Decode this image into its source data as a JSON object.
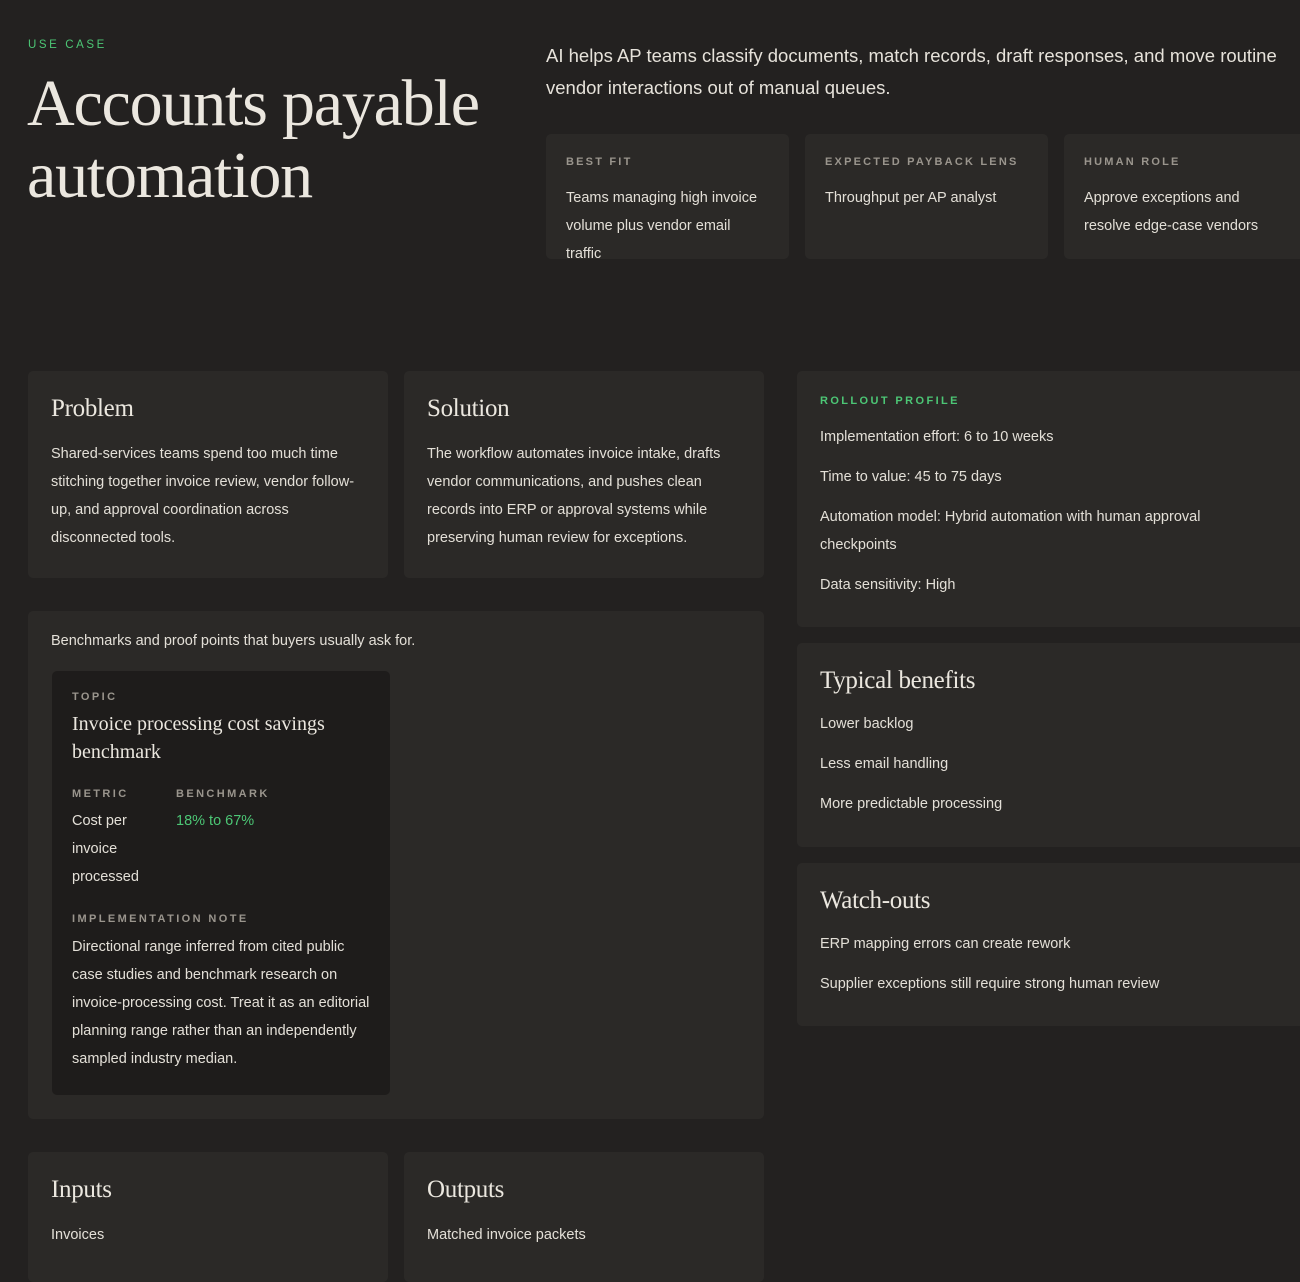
{
  "hero": {
    "eyebrow": "USE CASE",
    "title": "Accounts payable automation",
    "summary": "AI helps AP teams classify documents, match records, draft responses, and move routine vendor interactions out of manual queues."
  },
  "facts": [
    {
      "label": "BEST FIT",
      "value": "Teams managing high invoice volume plus vendor email traffic"
    },
    {
      "label": "EXPECTED PAYBACK LENS",
      "value": "Throughput per AP analyst"
    },
    {
      "label": "HUMAN ROLE",
      "value": "Approve exceptions and resolve edge-case vendors"
    }
  ],
  "problem": {
    "heading": "Problem",
    "text": "Shared-services teams spend too much time stitching together invoice review, vendor follow-up, and approval coordination across disconnected tools."
  },
  "solution": {
    "heading": "Solution",
    "text": "The workflow automates invoice intake, drafts vendor communications, and pushes clean records into ERP or approval systems while preserving human review for exceptions."
  },
  "benchmarks": {
    "intro": "Benchmarks and proof points that buyers usually ask for.",
    "card": {
      "topic_label": "TOPIC",
      "topic": "Invoice processing cost savings benchmark",
      "metric_label": "METRIC",
      "metric": "Cost per invoice processed",
      "benchmark_label": "BENCHMARK",
      "benchmark": "18% to 67%",
      "note_label": "IMPLEMENTATION NOTE",
      "note": "Directional range inferred from cited public case studies and benchmark research on invoice-processing cost. Treat it as an editorial planning range rather than an independently sampled industry median."
    }
  },
  "inputs": {
    "heading": "Inputs",
    "items": [
      "Invoices"
    ]
  },
  "outputs": {
    "heading": "Outputs",
    "items": [
      "Matched invoice packets"
    ]
  },
  "rollout": {
    "label": "ROLLOUT PROFILE",
    "items": [
      "Implementation effort: 6 to 10 weeks",
      "Time to value: 45 to 75 days",
      "Automation model: Hybrid automation with human approval checkpoints",
      "Data sensitivity: High"
    ]
  },
  "benefits": {
    "heading": "Typical benefits",
    "items": [
      "Lower backlog",
      "Less email handling",
      "More predictable processing"
    ]
  },
  "watchouts": {
    "heading": "Watch-outs",
    "items": [
      "ERP mapping errors can create rework",
      "Supplier exceptions still require strong human review"
    ]
  },
  "colors": {
    "background": "#232120",
    "panel": "#2b2927",
    "accent": "#4cc675"
  }
}
